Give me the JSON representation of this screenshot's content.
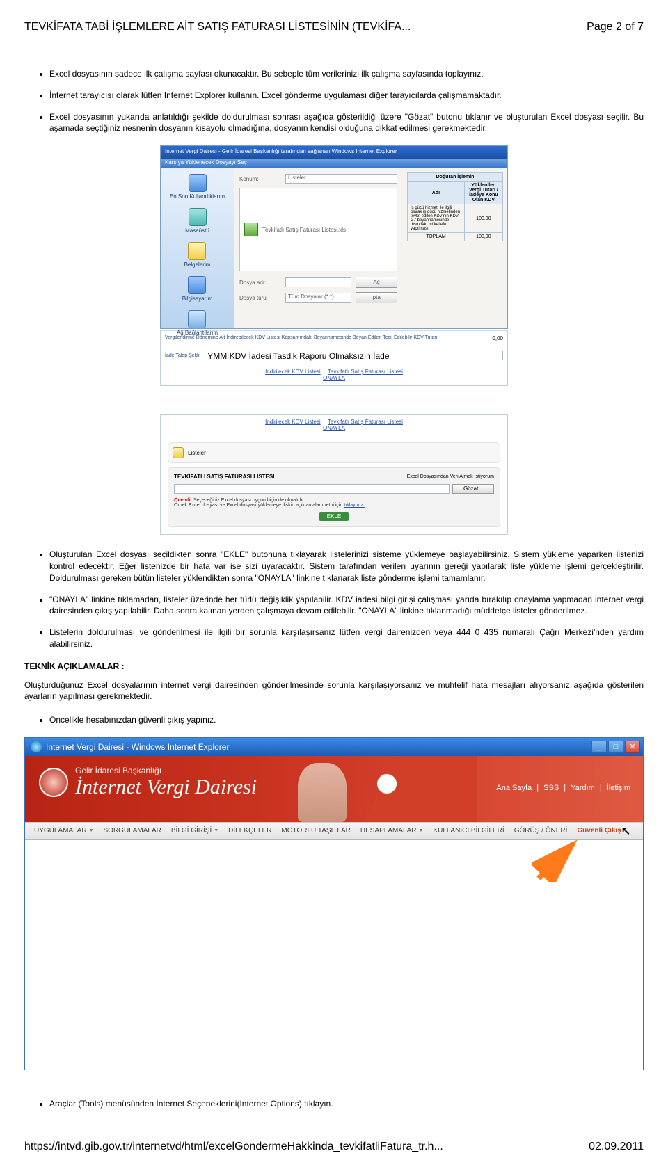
{
  "header": {
    "title": "TEVKİFATA TABİ İŞLEMLERE AİT SATIŞ FATURASI LİSTESİNİN (TEVKİFA...",
    "page": "Page 2 of 7"
  },
  "bullets_top": [
    "Excel dosyasının sadece ilk çalışma sayfası okunacaktır. Bu sebeple tüm verilerinizi ilk çalışma sayfasında toplayınız.",
    "İnternet tarayıcısı olarak lütfen Internet Explorer kullanın. Excel gönderme uygulaması diğer tarayıcılarda çalışmamaktadır.",
    "Excel dosyasının yukarıda anlatıldığı şekilde doldurulması sonrası aşağıda gösterildiği üzere \"Gözat\" butonu tıklanır ve oluşturulan Excel dosyası seçilir. Bu aşamada seçtiğiniz nesnenin dosyanın kısayolu olmadığına, dosyanın kendisi olduğuna dikkat edilmesi gerekmektedir."
  ],
  "ss1": {
    "explorer_title": "Internet Vergi Dairesi - Gelir İdaresi Başkanlığı tarafından sağlanan Windows Internet Explorer",
    "dialog_title": "Karşıya Yüklenecek Dosyayı Seç",
    "left_items": [
      "En Son Kullandıklarım",
      "Masaüstü",
      "Belgelerim",
      "Bilgisayarım",
      "Ağ Bağlantılarım"
    ],
    "row_konum_label": "Konum:",
    "row_konum_value": "Listeler",
    "file_item": "Tevkifatlı Satış Faturası Listesi.xls",
    "row_dosyaadi_label": "Dosya adı:",
    "row_dosyaturu_label": "Dosya türü:",
    "row_dosyaturu_value": "Tüm Dosyalar (*.*)",
    "btn_ac": "Aç",
    "btn_iptal": "İptal",
    "table": {
      "head1": "Doğuran İşlemin",
      "col1": "Adı",
      "col2": "Yüklenilen Vergi Tutarı / İadeye Konu Olan KDV",
      "row1_c1": "İş gücü hizmeti ile ilgili olarak iş gücü hizmetinden tevkif edilen KDV'nin KDV G7 beyannamesinde dışındaki mükellefe yapılması",
      "row1_c2": "100,00",
      "row_sum_label": "TOPLAM",
      "row_sum_val": "100,00"
    },
    "context_left": "Vergilendirme Dönemine Ait İndirebilecek KDV Listesi Kapsamındaki Beyannamesinde Beyan Edilen Tecil Edilebilir KDV Tutarı",
    "context_row2_label": "İade Talep Şekli",
    "context_row2_value": "YMM KDV İadesi Tasdik Raporu Olmaksızın İade",
    "context_value": "0,00",
    "link1": "İndirilecek KDV Listesi",
    "link2": "Tevkifatlı Satış Faturası Listesi",
    "link3": "ONAYLA"
  },
  "ss2": {
    "link1": "İndirilecek KDV Listesi",
    "link2": "Tevkifatlı Satış Faturası Listesi",
    "link3": "ONAYLA",
    "list_label": "Listeler",
    "band_title": "TEVKİFATLI SATIŞ FATURASI LİSTESİ",
    "band_right": "Excel Dosyasından Veri Almak İstiyorum",
    "gozat": "Gözat...",
    "warn_red": "Önemli:",
    "warn_line1": " Seçeceğiniz Excel dosyası uygun biçimde olmalıdır.",
    "warn_line2": "Örnek Excel dosyası ve Excel dosyası yüklemeye ilişkin açıklamalar metni için ",
    "warn_link": "tıklayınız.",
    "ekle": "EKLE"
  },
  "bullets_mid": [
    "Oluşturulan Excel dosyası seçildikten sonra \"EKLE\" butonuna tıklayarak listelerinizi sisteme yüklemeye başlayabilirsiniz. Sistem yükleme yaparken listenizi kontrol edecektir. Eğer listenizde bir hata var ise sizi uyaracaktır. Sistem tarafından verilen uyarının gereği yapılarak liste yükleme işlemi gerçekleştirilir. Doldurulması gereken bütün listeler yüklendikten sonra \"ONAYLA\" linkine tıklanarak liste gönderme işlemi tamamlanır.",
    "\"ONAYLA\" linkine tıklamadan, listeler üzerinde her türlü değişiklik yapılabilir. KDV iadesi bilgi girişi çalışması yarıda bırakılıp onaylama yapmadan internet vergi dairesinden çıkış yapılabilir. Daha sonra kalınan yerden çalışmaya devam edilebilir. \"ONAYLA\" linkine tıklanmadığı müddetçe listeler gönderilmez.",
    "Listelerin doldurulması ve gönderilmesi ile ilgili bir sorunla karşılaşırsanız lütfen vergi dairenizden veya 444 0 435 numaralı Çağrı Merkezi'nden yardım alabilirsiniz."
  ],
  "section_head": "TEKNİK AÇIKLAMALAR :",
  "section_para": "Oluşturduğunuz Excel dosyalarının internet vergi dairesinden gönderilmesinde sorunla karşılaşıyorsanız ve muhtelif hata mesajları alıyorsanız aşağıda gösterilen ayarların yapılması gerekmektedir.",
  "bullet_after": "Öncelikle hesabınızdan güvenli çıkış yapınız.",
  "ie": {
    "title": "Internet Vergi Dairesi - Windows Internet Explorer",
    "logo_small": "Gelir İdaresi Başkanlığı",
    "logo_big": "İnternet Vergi Dairesi",
    "top_links": [
      "Ana Sayfa",
      "SSS",
      "Yardım",
      "İletişim"
    ],
    "menu": [
      {
        "t": "UYGULAMALAR",
        "d": true
      },
      {
        "t": "SORGULAMALAR",
        "d": false
      },
      {
        "t": "BİLGİ GİRİŞİ",
        "d": true
      },
      {
        "t": "DİLEKÇELER",
        "d": false
      },
      {
        "t": "MOTORLU TAŞITLAR",
        "d": false
      },
      {
        "t": "HESAPLAMALAR",
        "d": true
      },
      {
        "t": "KULLANICI BİLGİLERİ",
        "d": false
      },
      {
        "t": "GÖRÜŞ / ÖNERİ",
        "d": false
      }
    ],
    "exit": "Güvenli Çıkış"
  },
  "bullet_bottom": "Araçlar (Tools) menüsünden İnternet Seçeneklerini(Internet Options) tıklayın.",
  "footer": {
    "url": "https://intvd.gib.gov.tr/internetvd/html/excelGondermeHakkinda_tevkifatliFatura_tr.h...",
    "date": "02.09.2011"
  }
}
